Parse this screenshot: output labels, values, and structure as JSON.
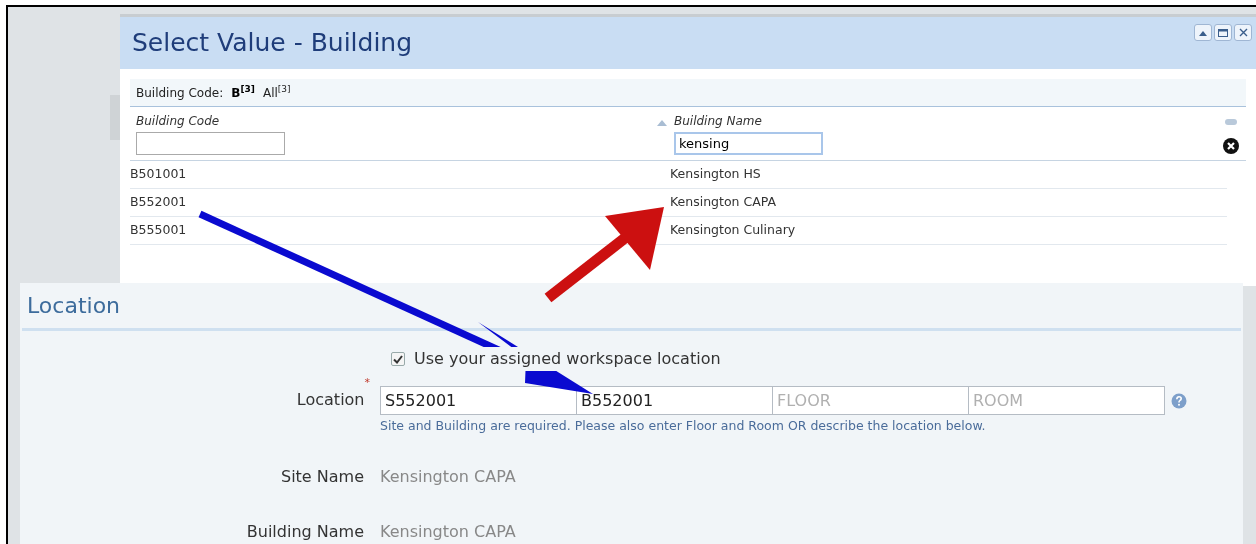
{
  "dialog": {
    "title": "Select Value - Building",
    "filter_label": "Building Code:",
    "filters": [
      {
        "label": "B$^{[3]}$",
        "selected": true
      },
      {
        "label": "All$^{[3]}$",
        "selected": false
      }
    ],
    "columns": [
      {
        "heading": "Building Code",
        "sorted": false
      },
      {
        "heading": "Building Name",
        "filter_value": "kensing",
        "sorted": true
      }
    ],
    "rows": [
      [
        "B501001",
        "Kensington HS"
      ],
      [
        "B552001",
        "Kensington CAPA"
      ],
      [
        "B555001",
        "Kensington Culinary"
      ]
    ]
  },
  "location": {
    "title": "Location",
    "use_assigned": {
      "label": "Use your assigned workspace location",
      "checked": true
    },
    "location_field": {
      "label": "Location",
      "required_mark": "*",
      "inputs": [
        {
          "value": "S552001"
        },
        {
          "value": "B552001"
        },
        {
          "placeholder": "FLOOR"
        },
        {
          "placeholder": "ROOM"
        }
      ],
      "hint": "Site and Building are required. Please also enter Floor and Room OR describe the location below."
    },
    "details": [
      {
        "label": "Site Name",
        "value": "Kensington CAPA"
      },
      {
        "label": "Building Name",
        "value": "Kensington CAPA"
      }
    ]
  }
}
